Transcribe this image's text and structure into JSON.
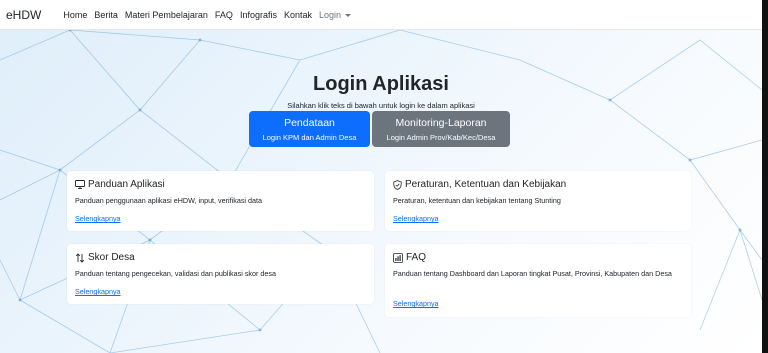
{
  "navbar": {
    "brand": "eHDW",
    "items": [
      "Home",
      "Berita",
      "Materi Pembelajaran",
      "FAQ",
      "Infografis",
      "Kontak"
    ],
    "login_label": "Login"
  },
  "hero": {
    "title": "Login Aplikasi",
    "subtitle": "Silahkan klik teks di bawah untuk login ke dalam aplikasi",
    "primary_button": {
      "title": "Pendataan",
      "subtitle": "Login KPM dan Admin Desa"
    },
    "secondary_button": {
      "title": "Monitoring-Laporan",
      "subtitle": "Login Admin Prov/Kab/Kec/Desa"
    }
  },
  "cards": [
    {
      "title": "Panduan Aplikasi",
      "text": "Panduan penggunaan aplikasi eHDW, input, verifikasi data",
      "link": "Selengkapnya",
      "icon": "monitor-icon"
    },
    {
      "title": "Peraturan, Ketentuan dan Kebijakan",
      "text": "Peraturan, ketentuan dan kebijakan tentang Stunting",
      "link": "Selengkapnya",
      "icon": "shield-check-icon"
    },
    {
      "title": "Skor Desa",
      "text": "Panduan tentang pengecekan, validasi dan publikasi skor desa",
      "link": "Selengkapnya",
      "icon": "sort-arrows-icon"
    },
    {
      "title": "FAQ",
      "text": "Panduan tentang Dashboard dan Laporan tingkat Pusat, Provinsi, Kabupaten dan Desa",
      "link": "Selengkapnya",
      "icon": "bar-chart-icon"
    }
  ],
  "colors": {
    "primary": "#0d6efd",
    "secondary": "#6c757d",
    "link": "#0d6efd"
  }
}
